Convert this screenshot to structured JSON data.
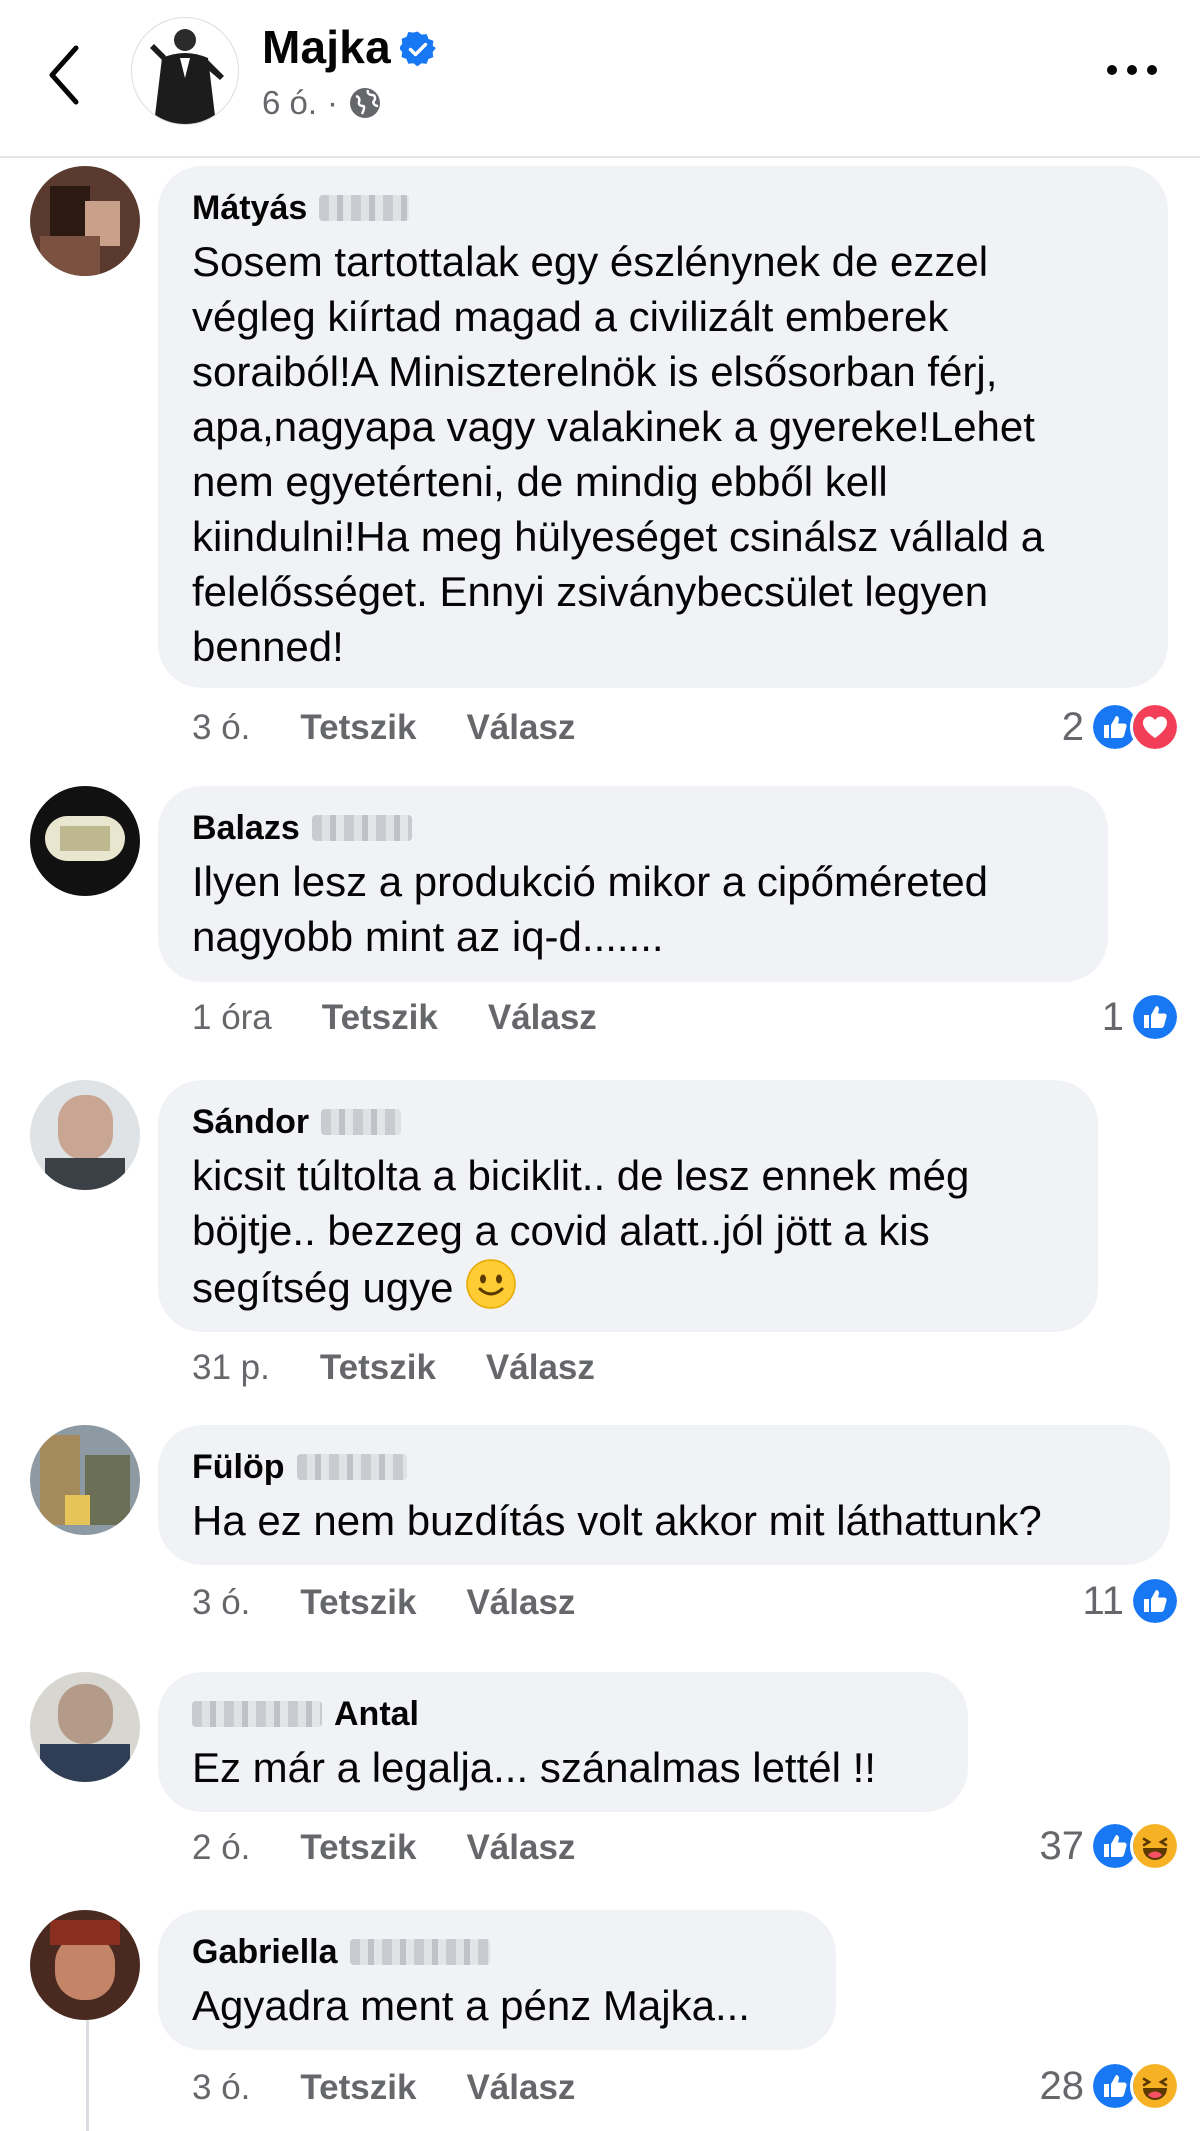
{
  "header": {
    "page_name": "Majka",
    "time": "6 ó.",
    "separator": "·"
  },
  "colors": {
    "facebook_blue": "#1877f2",
    "love_red": "#f33e58",
    "haha_yellow": "#f7b125",
    "bubble_gray": "#f0f2f5",
    "meta_gray": "#65676b"
  },
  "comments": [
    {
      "author_first": "Mátyás",
      "text": "Sosem tartottalak egy észlénynek de ezzel\nvégleg kiírtad magad a civilizált emberek\nsoraiból!A Miniszterelnök is elsősorban férj,\napa,nagyapa vagy valakinek a gyereke!Lehet\nnem egyetérteni, de mindig ebből kell\nkiindulni!Ha meg hülyeséget csinálsz vállald a\nfelelősséget. Ennyi zsiványbecsület legyen\nbenned!",
      "time": "3 ó.",
      "like": "Tetszik",
      "reply": "Válasz",
      "reaction_count": "2",
      "reaction_icons": [
        "like-icon",
        "love-icon"
      ]
    },
    {
      "author_first": "Balazs",
      "text": "Ilyen lesz a produkció mikor a cipőméreted\nnagyobb mint az iq-d.......",
      "time": "1 óra",
      "like": "Tetszik",
      "reply": "Válasz",
      "reaction_count": "1",
      "reaction_icons": [
        "like-icon"
      ]
    },
    {
      "author_first": "Sándor",
      "text_line1": "kicsit túltolta a biciklit.. de lesz ennek még",
      "text_line2": "böjtje.. bezzeg a covid alatt..jól jött a kis",
      "text_line3": "segítség ugye",
      "time": "31 p.",
      "like": "Tetszik",
      "reply": "Válasz",
      "reaction_icons": [
        "slightly-smiling-face-icon"
      ]
    },
    {
      "author_first": "Fülöp",
      "text": "Ha ez nem buzdítás volt akkor mit láthattunk?",
      "time": "3 ó.",
      "like": "Tetszik",
      "reply": "Válasz",
      "reaction_count": "11",
      "reaction_icons": [
        "like-icon"
      ]
    },
    {
      "author_last": "Antal",
      "text": "Ez már a legalja... szánalmas lettél !!",
      "time": "2 ó.",
      "like": "Tetszik",
      "reply": "Válasz",
      "reaction_count": "37",
      "reaction_icons": [
        "like-icon",
        "haha-icon"
      ]
    },
    {
      "author_first": "Gabriella",
      "text": "Agyadra ment a pénz Majka...",
      "time": "3 ó.",
      "like": "Tetszik",
      "reply": "Válasz",
      "reaction_count": "28",
      "reaction_icons": [
        "like-icon",
        "haha-icon"
      ]
    }
  ]
}
